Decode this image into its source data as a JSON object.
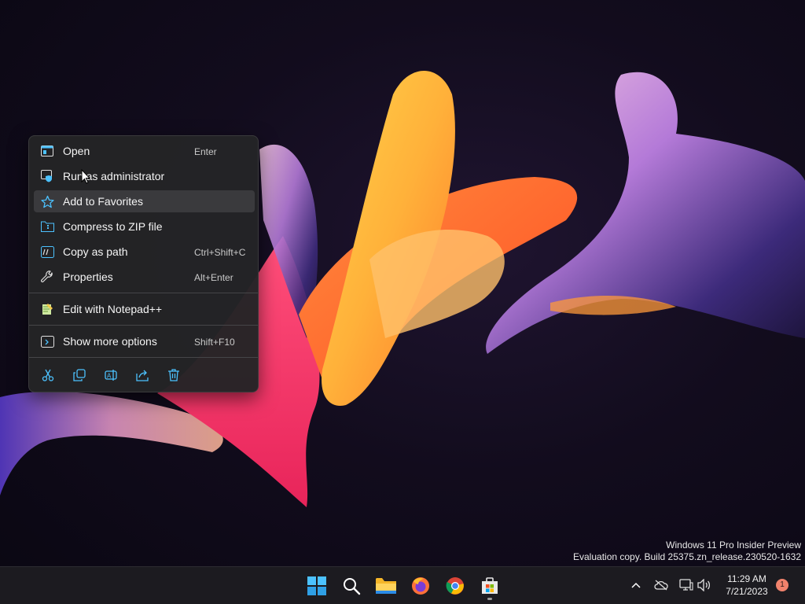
{
  "context_menu": {
    "items": [
      {
        "label": "Open",
        "shortcut": "Enter",
        "icon": "open-window-icon"
      },
      {
        "label": "Run as administrator",
        "shortcut": "",
        "icon": "shield-icon"
      },
      {
        "label": "Add to Favorites",
        "shortcut": "",
        "icon": "star-icon"
      },
      {
        "label": "Compress to ZIP file",
        "shortcut": "",
        "icon": "zip-icon"
      },
      {
        "label": "Copy as path",
        "shortcut": "Ctrl+Shift+C",
        "icon": "copy-path-icon"
      },
      {
        "label": "Properties",
        "shortcut": "Alt+Enter",
        "icon": "wrench-icon"
      },
      {
        "label": "Edit with Notepad++",
        "shortcut": "",
        "icon": "notepad-plus-plus-icon"
      },
      {
        "label": "Show more options",
        "shortcut": "Shift+F10",
        "icon": "more-options-icon"
      }
    ],
    "hovered_item": "Add to Favorites",
    "actions": [
      "cut-icon",
      "copy-icon",
      "rename-icon",
      "share-icon",
      "delete-icon"
    ]
  },
  "watermark": {
    "line1": "Windows 11 Pro Insider Preview",
    "line2": "Evaluation copy. Build 25375.zn_release.230520-1632"
  },
  "taskbar": {
    "apps": [
      "start-icon",
      "search-icon",
      "file-explorer-icon",
      "firefox-icon",
      "chrome-icon",
      "microsoft-store-icon"
    ],
    "tray": [
      "chevron-up-icon",
      "cloud-offline-icon",
      "network-icon",
      "volume-icon"
    ],
    "clock": {
      "time": "11:29 AM",
      "date": "7/21/2023"
    },
    "notification_count": "1"
  },
  "colors": {
    "menu_bg": "#242426",
    "accent_blue": "#4cc2ff",
    "taskbar_bg": "#1c1b20"
  }
}
